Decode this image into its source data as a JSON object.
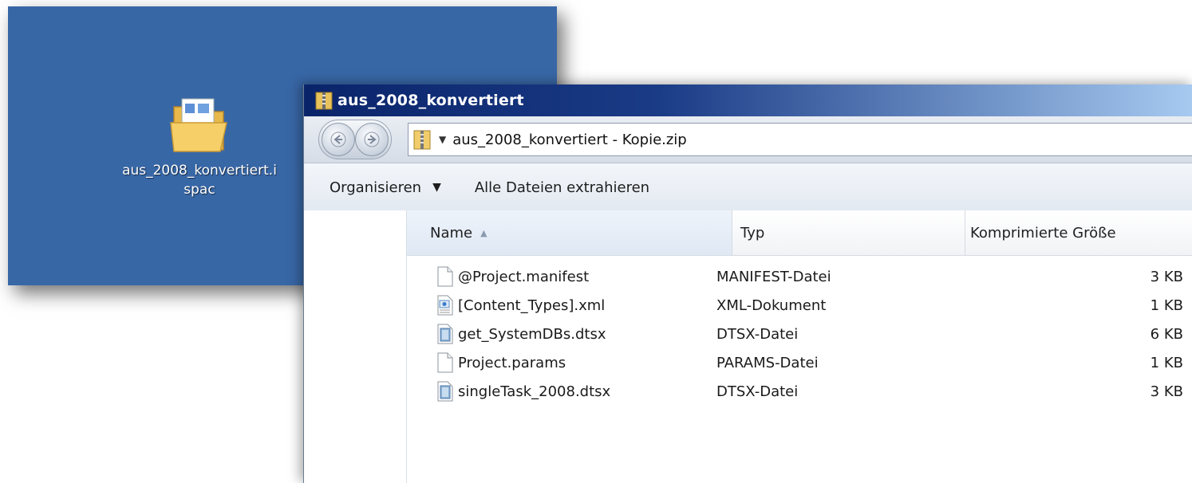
{
  "desktop": {
    "icon_label_line1": "aus_2008_konvertiert.i",
    "icon_label_line2": "spac",
    "background_color": "#3867a6",
    "icon": "folder-icon"
  },
  "window": {
    "title": "aus_2008_konvertiert",
    "address_path": "aus_2008_konvertiert - Kopie.zip",
    "back_icon": "back-arrow-icon",
    "forward_icon": "forward-arrow-icon"
  },
  "commands": {
    "organize": "Organisieren",
    "extract_all": "Alle Dateien extrahieren"
  },
  "columns": {
    "name": "Name",
    "type": "Typ",
    "compressed_size": "Komprimierte Größe"
  },
  "files": [
    {
      "name": "@Project.manifest",
      "type": "MANIFEST-Datei",
      "size": "3 KB",
      "icon": "blank-file-icon"
    },
    {
      "name": "[Content_Types].xml",
      "type": "XML-Dokument",
      "size": "1 KB",
      "icon": "xml-file-icon"
    },
    {
      "name": "get_SystemDBs.dtsx",
      "type": "DTSX-Datei",
      "size": "6 KB",
      "icon": "dtsx-file-icon"
    },
    {
      "name": "Project.params",
      "type": "PARAMS-Datei",
      "size": "1 KB",
      "icon": "blank-file-icon"
    },
    {
      "name": "singleTask_2008.dtsx",
      "type": "DTSX-Datei",
      "size": "3 KB",
      "icon": "dtsx-file-icon"
    }
  ]
}
